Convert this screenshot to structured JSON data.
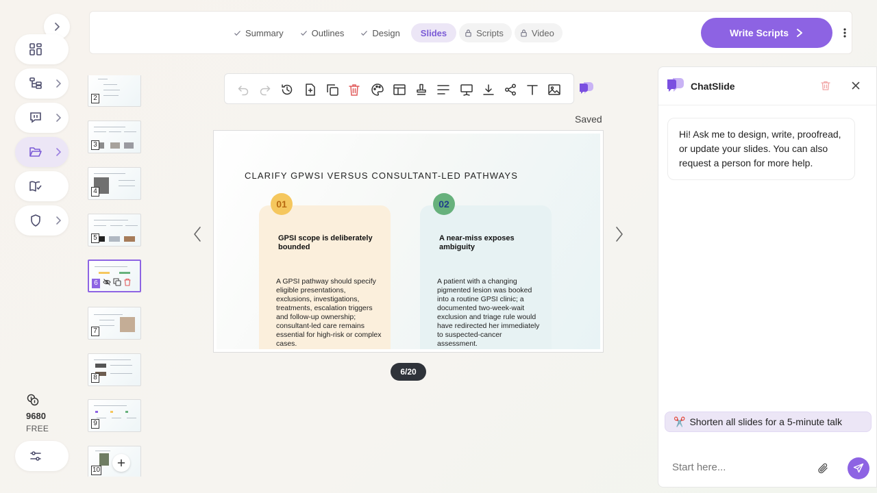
{
  "credits": {
    "amount": "9680",
    "plan": "FREE"
  },
  "steps": [
    {
      "label": "Summary",
      "state": "done"
    },
    {
      "label": "Outlines",
      "state": "done"
    },
    {
      "label": "Design",
      "state": "done"
    },
    {
      "label": "Slides",
      "state": "active"
    },
    {
      "label": "Scripts",
      "state": "locked"
    },
    {
      "label": "Video",
      "state": "locked"
    }
  ],
  "header": {
    "primary_button": "Write Scripts"
  },
  "editor": {
    "save_status": "Saved",
    "page_indicator": "6/20",
    "toolbar_icons": [
      "undo-icon",
      "redo-icon",
      "history-icon",
      "add-page-icon",
      "duplicate-icon",
      "delete-icon",
      "palette-icon",
      "layout-icon",
      "stamp-icon",
      "align-icon",
      "present-icon",
      "download-icon",
      "share-icon",
      "text-icon",
      "image-icon"
    ]
  },
  "thumbnails": [
    "2",
    "3",
    "4",
    "5",
    "6",
    "7",
    "8",
    "9",
    "10"
  ],
  "slide": {
    "title": "CLARIFY GPWSI VERSUS CONSULTANT-LED PATHWAYS",
    "cards": [
      {
        "number": "01",
        "heading": "GPSI scope is deliberately bounded",
        "body": "A GPSI pathway should specify eligible presentations, exclusions, investigations, treatments, escalation triggers and follow-up ownership; consultant-led care remains essential for high-risk or complex cases."
      },
      {
        "number": "02",
        "heading": "A near-miss exposes ambiguity",
        "body": "A patient with a changing pigmented lesion was booked into a routine GPSI clinic; a documented two-week-wait exclusion and triage rule would have redirected her immediately to suspected-cancer assessment."
      }
    ]
  },
  "chat": {
    "title": "ChatSlide",
    "greeting": "Hi! Ask me to design, write, proofread, or update your slides. You can also request a person for more help.",
    "suggestion_emoji": "✂️",
    "suggestion": "Shorten all slides for a 5-minute talk",
    "input_placeholder": "Start here..."
  },
  "colors": {
    "accent": "#8d63e3",
    "accent_soft": "#ece6f6",
    "danger": "#e05a5a"
  }
}
